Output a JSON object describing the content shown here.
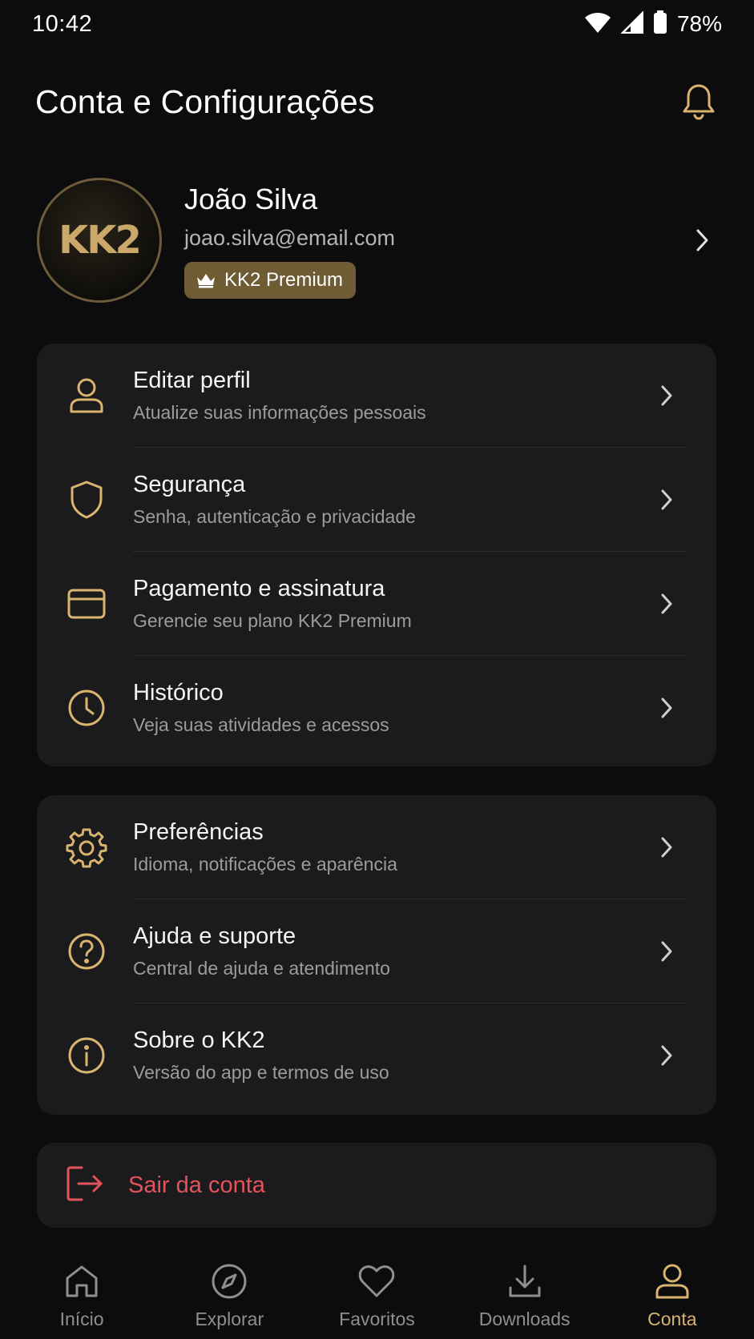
{
  "status": {
    "time": "10:42",
    "battery": "78%"
  },
  "header": {
    "title": "Conta e Configurações"
  },
  "profile": {
    "avatar_text": "KK2",
    "name": "João Silva",
    "email": "joao.silva@email.com",
    "badge": "KK2 Premium"
  },
  "account_menu": [
    {
      "title": "Editar perfil",
      "subtitle": "Atualize suas informações pessoais",
      "icon": "user-icon"
    },
    {
      "title": "Segurança",
      "subtitle": "Senha, autenticação e privacidade",
      "icon": "shield-icon"
    },
    {
      "title": "Pagamento e assinatura",
      "subtitle": "Gerencie seu plano KK2 Premium",
      "icon": "credit-card-icon"
    },
    {
      "title": "Histórico",
      "subtitle": "Veja suas atividades e acessos",
      "icon": "clock-icon"
    }
  ],
  "app_menu": [
    {
      "title": "Preferências",
      "subtitle": "Idioma, notificações e aparência",
      "icon": "gear-icon"
    },
    {
      "title": "Ajuda e suporte",
      "subtitle": "Central de ajuda e atendimento",
      "icon": "help-icon"
    },
    {
      "title": "Sobre o KK2",
      "subtitle": "Versão do app e termos de uso",
      "icon": "info-icon"
    }
  ],
  "logout": {
    "label": "Sair da conta"
  },
  "nav": {
    "items": [
      {
        "label": "Início",
        "icon": "home-icon"
      },
      {
        "label": "Explorar",
        "icon": "compass-icon"
      },
      {
        "label": "Favoritos",
        "icon": "heart-icon"
      },
      {
        "label": "Downloads",
        "icon": "download-icon"
      },
      {
        "label": "Conta",
        "icon": "user-icon"
      }
    ],
    "active": "Conta"
  },
  "colors": {
    "accent": "#d9b46f",
    "danger": "#e5535a",
    "card": "#1b1b1d",
    "background": "#0c0c0e"
  }
}
